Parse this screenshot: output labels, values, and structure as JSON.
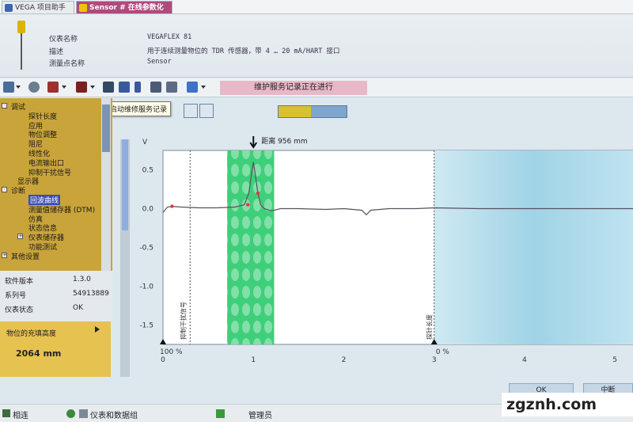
{
  "tabs": [
    {
      "label": "VEGA 项目助手"
    },
    {
      "label": "Sensor # 在线参数化"
    }
  ],
  "device": {
    "rows": [
      {
        "label": "仪表名称",
        "value": "VEGAFLEX 81"
      },
      {
        "label": "描述",
        "value": "用于连续测量物位的 TDR 传感器，带 4 … 20 mA/HART 接口"
      },
      {
        "label": "测量点名称",
        "value": "Sensor"
      }
    ]
  },
  "toolbar": {
    "service_status": "维护服务记录正在进行",
    "tooltip": "启动维修服务记录"
  },
  "tree": {
    "items": [
      {
        "label": "调试",
        "level": 0,
        "expander": "-"
      },
      {
        "label": "探针长度",
        "level": 2
      },
      {
        "label": "应用",
        "level": 2
      },
      {
        "label": "物位调整",
        "level": 2
      },
      {
        "label": "阻尼",
        "level": 2
      },
      {
        "label": "线性化",
        "level": 2
      },
      {
        "label": "电流输出口",
        "level": 2
      },
      {
        "label": "抑制干扰信号",
        "level": 2
      },
      {
        "label": "显示器",
        "level": 1
      },
      {
        "label": "诊断",
        "level": 0,
        "expander": "-"
      },
      {
        "label": "回波曲线",
        "level": 2,
        "selected": true
      },
      {
        "label": "测量值储存器 (DTM)",
        "level": 2
      },
      {
        "label": "仿真",
        "level": 2
      },
      {
        "label": "状态信息",
        "level": 2
      },
      {
        "label": "仪表储存器",
        "level": 2,
        "expander": "+"
      },
      {
        "label": "功能测试",
        "level": 2
      },
      {
        "label": "其他设置",
        "level": 0,
        "expander": "+"
      }
    ]
  },
  "info": {
    "rows": [
      {
        "label": "软件版本",
        "value": "1.3.0"
      },
      {
        "label": "系列号",
        "value": "54913889"
      },
      {
        "label": "仪表状态",
        "value": "OK"
      }
    ]
  },
  "fill_height": {
    "label": "物位的充填高度",
    "value": "2064 mm"
  },
  "progress": {
    "fraction": 0.48
  },
  "chart_data": {
    "type": "line",
    "ylabel": "V",
    "y_ticks": [
      "0.5",
      "0.0",
      "-0.5",
      "-1.0",
      "-1.5"
    ],
    "x_ticks": [
      "0",
      "1",
      "2",
      "3",
      "4",
      "5"
    ],
    "ylim": [
      -1.75,
      0.75
    ],
    "xlim": [
      0,
      5.2
    ],
    "distance_label": "距离 956 mm",
    "pct_100": "100 %",
    "pct_0": "0 %",
    "marker_left_label": "抑制干扰信号",
    "marker_right_label": "探针长度",
    "highlight_range": [
      0.71,
      1.23
    ],
    "probe_end_x": 3.0,
    "x": [
      0.0,
      0.02,
      0.05,
      0.1,
      0.2,
      0.4,
      0.6,
      0.8,
      0.9,
      0.95,
      0.98,
      1.0,
      1.02,
      1.05,
      1.08,
      1.12,
      1.2,
      1.3,
      1.5,
      1.8,
      2.0,
      2.1,
      2.2,
      2.25,
      2.3,
      2.5,
      2.8,
      3.0,
      3.5,
      4.0,
      4.5,
      5.0,
      5.2
    ],
    "y": [
      -0.05,
      -0.02,
      0.02,
      0.03,
      0.02,
      0.01,
      0.01,
      0.02,
      0.05,
      0.2,
      0.45,
      0.6,
      0.45,
      0.2,
      0.05,
      0.0,
      -0.03,
      0.0,
      0.0,
      -0.01,
      0.0,
      -0.01,
      -0.02,
      -0.08,
      -0.02,
      0.0,
      0.0,
      0.01,
      0.0,
      0.0,
      0.0,
      0.0,
      0.0
    ]
  },
  "buttons": {
    "ok": "OK",
    "cancel": "中断"
  },
  "status_bar": {
    "connection": "相连",
    "device_data": "仪表和数据组",
    "user": "管理员"
  },
  "watermark": {
    "text": "zgznh.com"
  }
}
